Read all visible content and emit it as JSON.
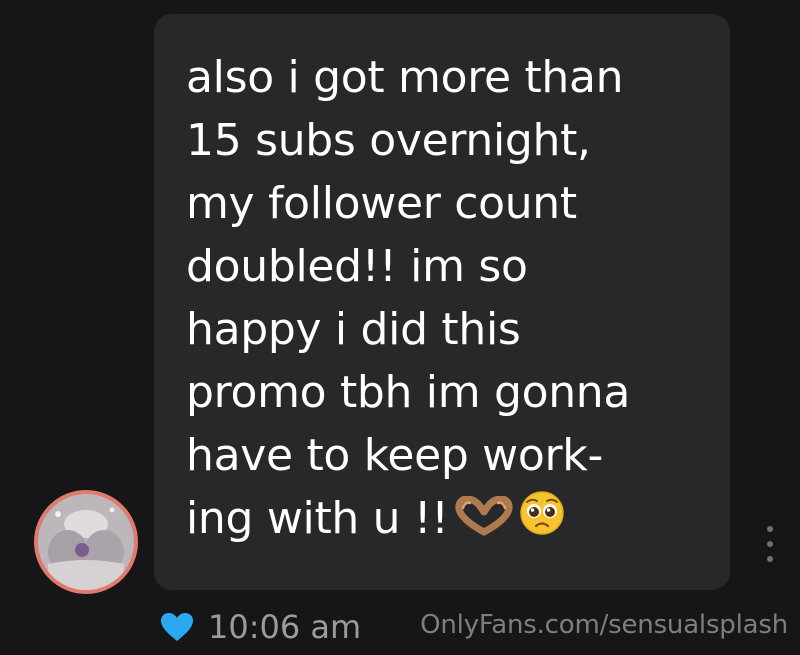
{
  "message": {
    "lines": [
      "also i got more than",
      "15 subs overnight,",
      "my follower count",
      "doubled!! im so",
      "happy i did this",
      "promo tbh im gonna",
      "have to keep work-",
      "ing with u !!"
    ],
    "emojis": [
      "heart-hands-emoji",
      "pleading-face-emoji"
    ]
  },
  "meta": {
    "time": "10:06 am",
    "liked": true,
    "like_icon": "heart-icon",
    "like_color": "#2aa9f0"
  },
  "menu_icon": "more-vertical-icon",
  "watermark": "OnlyFans.com/sensualsplash",
  "colors": {
    "background": "#161618",
    "bubble": "#272829",
    "text": "#ffffff",
    "avatar_ring": "#e07b6b"
  }
}
